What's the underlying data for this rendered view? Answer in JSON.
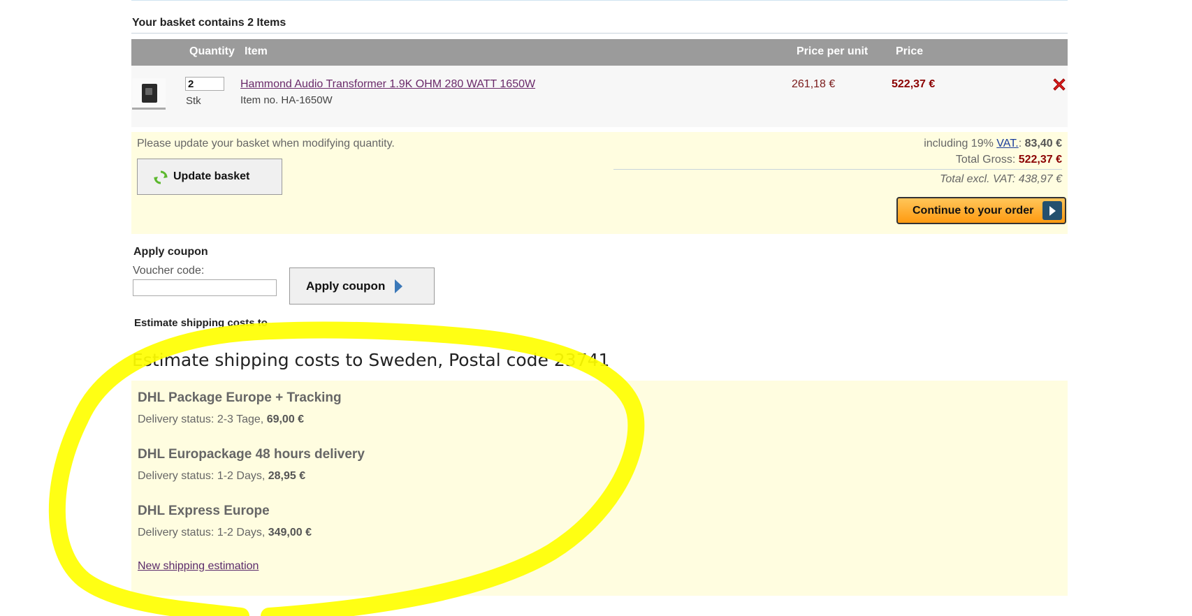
{
  "basket": {
    "title": "Your basket contains 2 Items"
  },
  "table": {
    "headers": {
      "quantity": "Quantity",
      "item": "Item",
      "price_per_unit": "Price per unit",
      "price": "Price"
    },
    "rows": [
      {
        "quantity": "2",
        "unit": "Stk",
        "name": "Hammond Audio Transformer 1.9K OHM 280 WATT 1650W",
        "item_no": "Item no. HA-1650W",
        "price_per_unit": "261,18 €",
        "price": "522,37 €"
      }
    ]
  },
  "update": {
    "note": "Please update your basket when modifying quantity.",
    "button_label": "Update basket"
  },
  "summary": {
    "vat_prefix": "including 19%",
    "vat_link": "VAT.",
    "vat_separator": ":",
    "vat_amount": "83,40 €",
    "gross_label": "Total Gross:",
    "gross_amount": "522,37 €",
    "excl_label": "Total excl. VAT: 438,97 €",
    "continue_label": "Continue to your order"
  },
  "coupon": {
    "title": "Apply coupon",
    "voucher_label": "Voucher code:",
    "voucher_value": "",
    "button_label": "Apply coupon"
  },
  "shipping": {
    "small_title": "Estimate shipping costs to",
    "heading": "Estimate shipping costs to Sweden, Postal code 23741",
    "options": [
      {
        "name": "DHL Package Europe + Tracking",
        "status": "Delivery status: 2-3 Tage,",
        "cost": "69,00 €"
      },
      {
        "name": "DHL Europackage 48 hours delivery",
        "status": "Delivery status: 1-2 Days,",
        "cost": "28,95 €"
      },
      {
        "name": "DHL Express Europe",
        "status": "Delivery status: 1-2 Days,",
        "cost": "349,00 €"
      }
    ],
    "new_estimation": "New shipping estimation"
  },
  "colors": {
    "header_bg": "#9b9b9b",
    "panel_bg": "#fffde0",
    "price_red": "#8b0000",
    "highlight_yellow": "#ffff00",
    "continue_orange": "#ff9a10"
  },
  "icons": {
    "remove": "red-x-icon",
    "refresh": "refresh-icon",
    "continue_arrow": "arrow-right-icon",
    "coupon_arrow": "arrow-right-icon"
  }
}
